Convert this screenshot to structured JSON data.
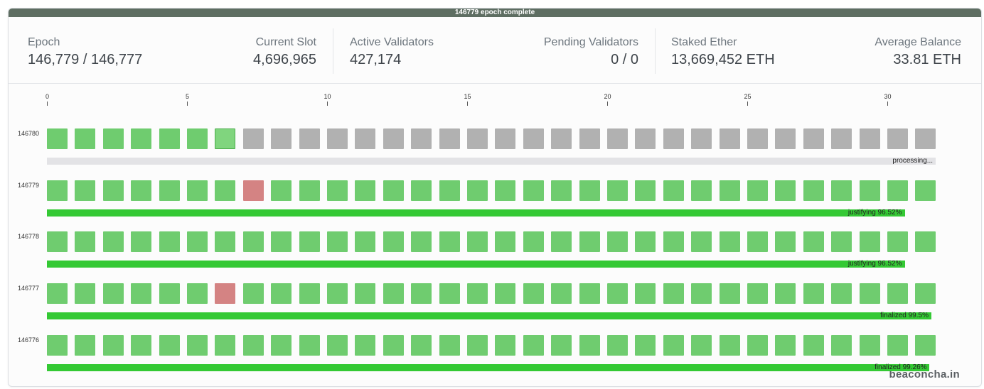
{
  "banner": {
    "text": "146779 epoch complete"
  },
  "stats": [
    {
      "label": "Epoch",
      "value": "146,779 / 146,777"
    },
    {
      "label": "Current Slot",
      "value": "4,696,965"
    },
    {
      "label": "Active Validators",
      "value": "427,174"
    },
    {
      "label": "Pending Validators",
      "value": "0 / 0"
    },
    {
      "label": "Staked Ether",
      "value": "13,669,452 ETH"
    },
    {
      "label": "Average Balance",
      "value": "33.81 ETH"
    }
  ],
  "axis_labels": [
    "0",
    "5",
    "10",
    "15",
    "20",
    "25",
    "30"
  ],
  "axis_values": [
    0,
    5,
    10,
    15,
    20,
    25,
    30
  ],
  "slots_per_epoch": 32,
  "epochs": [
    {
      "label": "146780",
      "status": "processing...",
      "progress": 1.0,
      "fill_color": "#e3e3e6",
      "current_slot": 6,
      "filled_slots": 6,
      "missed_slots": []
    },
    {
      "label": "146779",
      "status": "justifying 96.52%",
      "progress": 0.9652,
      "fill_color": "#34c934",
      "filled_slots": 32,
      "missed_slots": [
        7
      ]
    },
    {
      "label": "146778",
      "status": "justifying 96.52%",
      "progress": 0.9652,
      "fill_color": "#34c934",
      "filled_slots": 32,
      "missed_slots": []
    },
    {
      "label": "146777",
      "status": "finalized 99.5%",
      "progress": 0.995,
      "fill_color": "#34c934",
      "filled_slots": 32,
      "missed_slots": [
        6
      ]
    },
    {
      "label": "146776",
      "status": "finalized 99.26%",
      "progress": 0.9926,
      "fill_color": "#34c934",
      "filled_slots": 32,
      "missed_slots": []
    }
  ],
  "colors": {
    "proposed": "#6fcc6f",
    "scheduled": "#b1b1b1",
    "missed": "#d48383",
    "progress": "#34c934"
  },
  "brand": "beaconcha.in"
}
